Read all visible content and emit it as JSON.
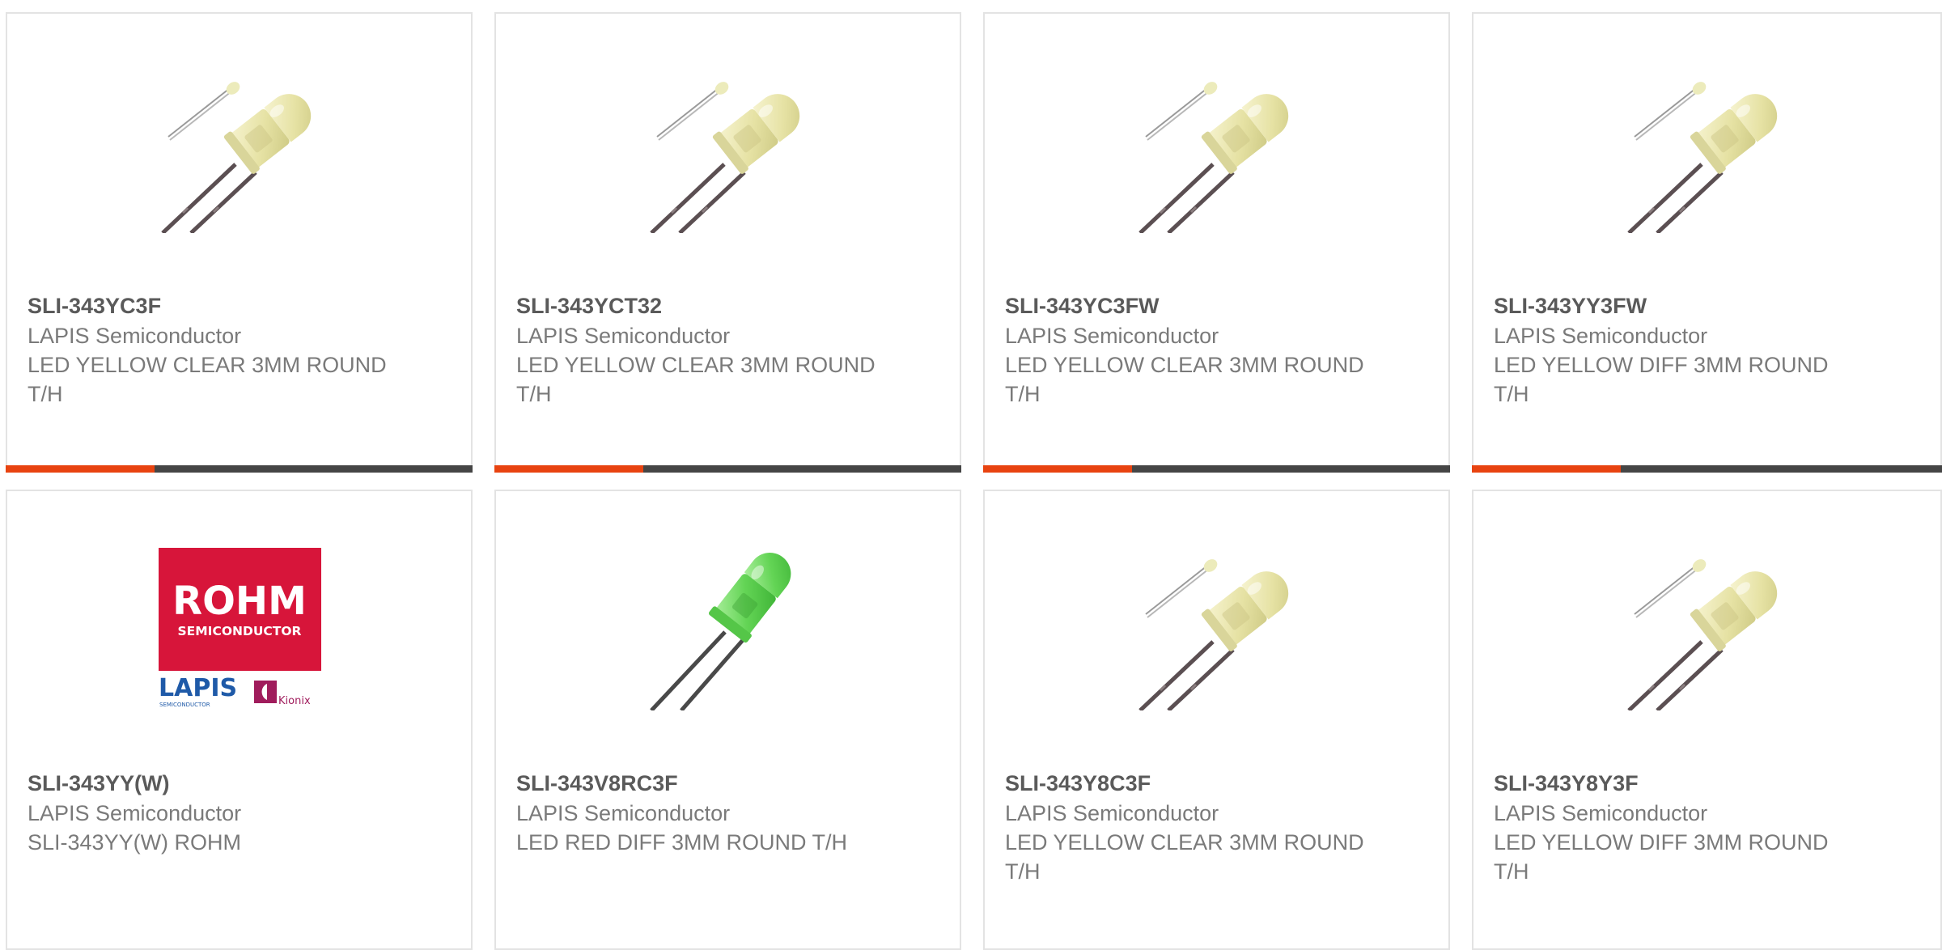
{
  "colors": {
    "card_border": "#e3e3e3",
    "part_number_text": "#5a5a5a",
    "body_text": "#7a7a7a",
    "accent_orange": "#e84310",
    "accent_dark": "#454545",
    "rohm_red": "#d7153a",
    "lapis_blue": "#1f5aa8",
    "kionix_magenta": "#a01c5c"
  },
  "products": [
    {
      "part_number": "SLI-343YC3F",
      "manufacturer": "LAPIS Semiconductor",
      "description": "LED YELLOW CLEAR 3MM ROUND T/H",
      "image_icon": "yellow-led-icon"
    },
    {
      "part_number": "SLI-343YCT32",
      "manufacturer": "LAPIS Semiconductor",
      "description": "LED YELLOW CLEAR 3MM ROUND T/H",
      "image_icon": "yellow-led-icon"
    },
    {
      "part_number": "SLI-343YC3FW",
      "manufacturer": "LAPIS Semiconductor",
      "description": "LED YELLOW CLEAR 3MM ROUND T/H",
      "image_icon": "yellow-led-icon"
    },
    {
      "part_number": "SLI-343YY3FW",
      "manufacturer": "LAPIS Semiconductor",
      "description": "LED YELLOW DIFF 3MM ROUND T/H",
      "image_icon": "yellow-led-icon"
    },
    {
      "part_number": "SLI-343YY(W)",
      "manufacturer": "LAPIS Semiconductor",
      "description": "SLI-343YY(W) ROHM",
      "image_icon": "rohm-lapis-kionix-logo",
      "logo_text": {
        "rohm": "ROHM",
        "semiconductor": "SEMICONDUCTOR",
        "lapis": "LAPIS",
        "lapis_sub": "SEMICONDUCTOR",
        "kionix": "Kionix"
      }
    },
    {
      "part_number": "SLI-343V8RC3F",
      "manufacturer": "LAPIS Semiconductor",
      "description": "LED RED DIFF 3MM ROUND T/H",
      "image_icon": "green-led-icon"
    },
    {
      "part_number": "SLI-343Y8C3F",
      "manufacturer": "LAPIS Semiconductor",
      "description": "LED YELLOW CLEAR 3MM ROUND T/H",
      "image_icon": "yellow-led-icon"
    },
    {
      "part_number": "SLI-343Y8Y3F",
      "manufacturer": "LAPIS Semiconductor",
      "description": "LED YELLOW DIFF 3MM ROUND T/H",
      "image_icon": "yellow-led-icon"
    }
  ]
}
